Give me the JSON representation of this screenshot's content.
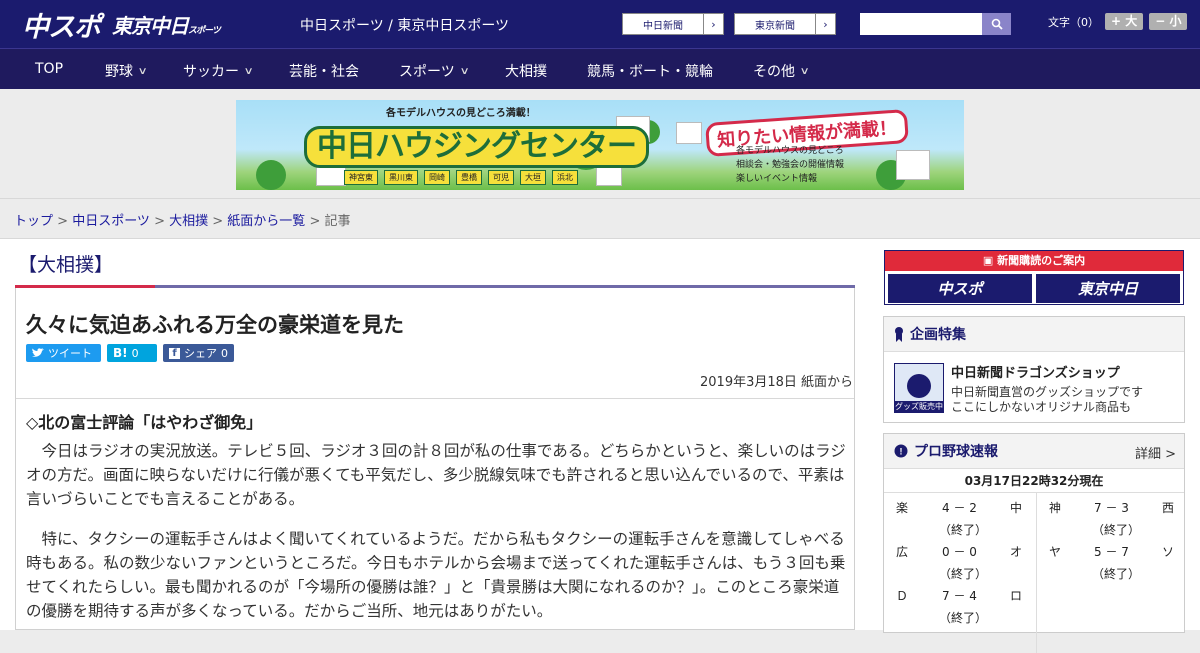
{
  "header": {
    "logo_main": "中スポ",
    "logo_sub": "東京中日",
    "logo_sub_small": "スポーツ",
    "site_name": "中日スポーツ / 東京中日スポーツ",
    "ext_links": [
      {
        "label": "中日新聞"
      },
      {
        "label": "東京新聞"
      }
    ],
    "font_size_label": "文字（0）",
    "font_larger": "+ 大",
    "font_smaller": "− 小"
  },
  "nav": {
    "items": [
      {
        "label": "TOP",
        "has_menu": false
      },
      {
        "label": "野球",
        "has_menu": true
      },
      {
        "label": "サッカー",
        "has_menu": true
      },
      {
        "label": "芸能・社会",
        "has_menu": false
      },
      {
        "label": "スポーツ",
        "has_menu": true
      },
      {
        "label": "大相撲",
        "has_menu": false
      },
      {
        "label": "競馬・ボート・競輪",
        "has_menu": false
      },
      {
        "label": "その他",
        "has_menu": true
      }
    ]
  },
  "banner": {
    "top_text": "各モデルハウスの見どころ満載！",
    "title": "中日ハウジングセンター",
    "callout": "知りたい情報が満載！",
    "list": [
      "各モデルハウスの見どころ",
      "相談会・勉強会の開催情報",
      "楽しいイベント情報"
    ],
    "towns": [
      "神宮東",
      "黒川東",
      "岡崎",
      "豊橋",
      "可児",
      "大垣",
      "浜北"
    ]
  },
  "breadcrumb": {
    "items": [
      "トップ",
      "中日スポーツ",
      "大相撲",
      "紙面から一覧"
    ],
    "current": "記事",
    "separator": " > "
  },
  "article": {
    "category": "【大相撲】",
    "title": "久々に気迫あふれる万全の豪栄道を見た",
    "share": {
      "tweet": "ツイート",
      "hatena_count": "0",
      "fb_label": "シェア",
      "fb_count": "0"
    },
    "date": "2019年3月18日 紙面から",
    "subhead": "◇北の富士評論「はやわざ御免」",
    "paragraphs": [
      "　今日はラジオの実況放送。テレビ５回、ラジオ３回の計８回が私の仕事である。どちらかというと、楽しいのはラジオの方だ。画面に映らないだけに行儀が悪くても平気だし、多少脱線気味でも許されると思い込んでいるので、平素は言いづらいことでも言えることがある。",
      "　特に、タクシーの運転手さんはよく聞いてくれているようだ。だから私もタクシーの運転手さんを意識してしゃべる時もある。私の数少ないファンというところだ。今日もホテルから会場まで送ってくれた運転手さんは、もう３回も乗せてくれたらしい。最も聞かれるのが「今場所の優勝は誰？」と「貴景勝は大関になれるのか？」。このところ豪栄道の優勝を期待する声が多くなっている。だからご当所、地元はありがたい。"
    ]
  },
  "sidebar": {
    "subscribe_head": "新聞購読のご案内",
    "subscribe_logos": [
      "中スポ",
      "東京中日"
    ],
    "feature": {
      "heading": "企画特集",
      "item_title": "中日新聞ドラゴンズショップ",
      "item_desc1": "中日新聞直営のグッズショップです",
      "item_desc2": "ここにしかないオリジナル商品も",
      "thumb_label": "グッズ販売中"
    },
    "baseball": {
      "heading": "プロ野球速報",
      "detail": "詳細 >",
      "updated": "03月17日22時32分現在",
      "games_left": [
        {
          "home": "楽",
          "score": "4 － 2",
          "away": "中",
          "status": "（終了）"
        },
        {
          "home": "広",
          "score": "0 － 0",
          "away": "オ",
          "status": "（終了）"
        },
        {
          "home": "Ｄ",
          "score": "7 － 4",
          "away": "ロ",
          "status": "（終了）"
        }
      ],
      "games_right": [
        {
          "home": "神",
          "score": "7 － 3",
          "away": "西",
          "status": "（終了）"
        },
        {
          "home": "ヤ",
          "score": "5 － 7",
          "away": "ソ",
          "status": "（終了）"
        }
      ]
    }
  },
  "colors": {
    "header_bg": "#1b1b6e",
    "nav_bg": "#1f1a5e",
    "accent_red": "#d42a4a",
    "link": "#1b1b9e",
    "twitter": "#1d9bf0",
    "hatena": "#00a4de",
    "facebook": "#3b5998"
  }
}
